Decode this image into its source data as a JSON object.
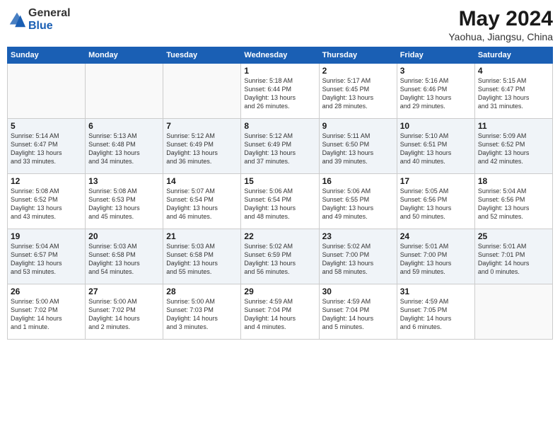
{
  "logo": {
    "general": "General",
    "blue": "Blue"
  },
  "title": {
    "month_year": "May 2024",
    "location": "Yaohua, Jiangsu, China"
  },
  "weekdays": [
    "Sunday",
    "Monday",
    "Tuesday",
    "Wednesday",
    "Thursday",
    "Friday",
    "Saturday"
  ],
  "weeks": [
    [
      {
        "day": "",
        "info": ""
      },
      {
        "day": "",
        "info": ""
      },
      {
        "day": "",
        "info": ""
      },
      {
        "day": "1",
        "info": "Sunrise: 5:18 AM\nSunset: 6:44 PM\nDaylight: 13 hours\nand 26 minutes."
      },
      {
        "day": "2",
        "info": "Sunrise: 5:17 AM\nSunset: 6:45 PM\nDaylight: 13 hours\nand 28 minutes."
      },
      {
        "day": "3",
        "info": "Sunrise: 5:16 AM\nSunset: 6:46 PM\nDaylight: 13 hours\nand 29 minutes."
      },
      {
        "day": "4",
        "info": "Sunrise: 5:15 AM\nSunset: 6:47 PM\nDaylight: 13 hours\nand 31 minutes."
      }
    ],
    [
      {
        "day": "5",
        "info": "Sunrise: 5:14 AM\nSunset: 6:47 PM\nDaylight: 13 hours\nand 33 minutes."
      },
      {
        "day": "6",
        "info": "Sunrise: 5:13 AM\nSunset: 6:48 PM\nDaylight: 13 hours\nand 34 minutes."
      },
      {
        "day": "7",
        "info": "Sunrise: 5:12 AM\nSunset: 6:49 PM\nDaylight: 13 hours\nand 36 minutes."
      },
      {
        "day": "8",
        "info": "Sunrise: 5:12 AM\nSunset: 6:49 PM\nDaylight: 13 hours\nand 37 minutes."
      },
      {
        "day": "9",
        "info": "Sunrise: 5:11 AM\nSunset: 6:50 PM\nDaylight: 13 hours\nand 39 minutes."
      },
      {
        "day": "10",
        "info": "Sunrise: 5:10 AM\nSunset: 6:51 PM\nDaylight: 13 hours\nand 40 minutes."
      },
      {
        "day": "11",
        "info": "Sunrise: 5:09 AM\nSunset: 6:52 PM\nDaylight: 13 hours\nand 42 minutes."
      }
    ],
    [
      {
        "day": "12",
        "info": "Sunrise: 5:08 AM\nSunset: 6:52 PM\nDaylight: 13 hours\nand 43 minutes."
      },
      {
        "day": "13",
        "info": "Sunrise: 5:08 AM\nSunset: 6:53 PM\nDaylight: 13 hours\nand 45 minutes."
      },
      {
        "day": "14",
        "info": "Sunrise: 5:07 AM\nSunset: 6:54 PM\nDaylight: 13 hours\nand 46 minutes."
      },
      {
        "day": "15",
        "info": "Sunrise: 5:06 AM\nSunset: 6:54 PM\nDaylight: 13 hours\nand 48 minutes."
      },
      {
        "day": "16",
        "info": "Sunrise: 5:06 AM\nSunset: 6:55 PM\nDaylight: 13 hours\nand 49 minutes."
      },
      {
        "day": "17",
        "info": "Sunrise: 5:05 AM\nSunset: 6:56 PM\nDaylight: 13 hours\nand 50 minutes."
      },
      {
        "day": "18",
        "info": "Sunrise: 5:04 AM\nSunset: 6:56 PM\nDaylight: 13 hours\nand 52 minutes."
      }
    ],
    [
      {
        "day": "19",
        "info": "Sunrise: 5:04 AM\nSunset: 6:57 PM\nDaylight: 13 hours\nand 53 minutes."
      },
      {
        "day": "20",
        "info": "Sunrise: 5:03 AM\nSunset: 6:58 PM\nDaylight: 13 hours\nand 54 minutes."
      },
      {
        "day": "21",
        "info": "Sunrise: 5:03 AM\nSunset: 6:58 PM\nDaylight: 13 hours\nand 55 minutes."
      },
      {
        "day": "22",
        "info": "Sunrise: 5:02 AM\nSunset: 6:59 PM\nDaylight: 13 hours\nand 56 minutes."
      },
      {
        "day": "23",
        "info": "Sunrise: 5:02 AM\nSunset: 7:00 PM\nDaylight: 13 hours\nand 58 minutes."
      },
      {
        "day": "24",
        "info": "Sunrise: 5:01 AM\nSunset: 7:00 PM\nDaylight: 13 hours\nand 59 minutes."
      },
      {
        "day": "25",
        "info": "Sunrise: 5:01 AM\nSunset: 7:01 PM\nDaylight: 14 hours\nand 0 minutes."
      }
    ],
    [
      {
        "day": "26",
        "info": "Sunrise: 5:00 AM\nSunset: 7:02 PM\nDaylight: 14 hours\nand 1 minute."
      },
      {
        "day": "27",
        "info": "Sunrise: 5:00 AM\nSunset: 7:02 PM\nDaylight: 14 hours\nand 2 minutes."
      },
      {
        "day": "28",
        "info": "Sunrise: 5:00 AM\nSunset: 7:03 PM\nDaylight: 14 hours\nand 3 minutes."
      },
      {
        "day": "29",
        "info": "Sunrise: 4:59 AM\nSunset: 7:04 PM\nDaylight: 14 hours\nand 4 minutes."
      },
      {
        "day": "30",
        "info": "Sunrise: 4:59 AM\nSunset: 7:04 PM\nDaylight: 14 hours\nand 5 minutes."
      },
      {
        "day": "31",
        "info": "Sunrise: 4:59 AM\nSunset: 7:05 PM\nDaylight: 14 hours\nand 6 minutes."
      },
      {
        "day": "",
        "info": ""
      }
    ]
  ]
}
